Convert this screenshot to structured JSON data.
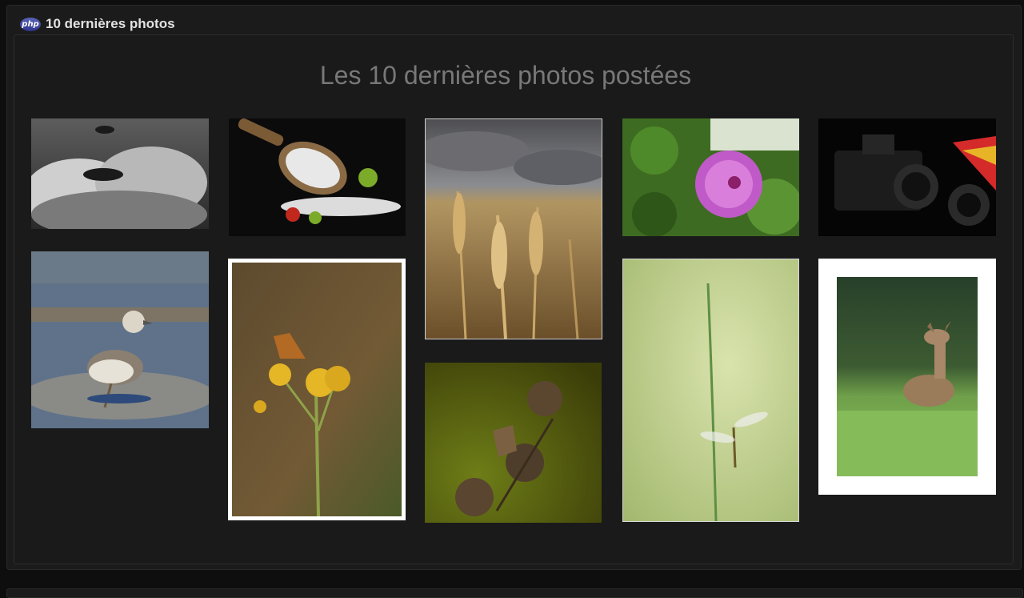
{
  "window": {
    "title": "10 dernières photos",
    "icon": "php-icon",
    "icon_text": "php"
  },
  "gallery": {
    "heading": "Les 10 dernières photos postées"
  },
  "colors": {
    "background": "#0e0e0e",
    "panel": "#1b1b1b",
    "heading": "#787878",
    "title": "#e2e2e2"
  }
}
